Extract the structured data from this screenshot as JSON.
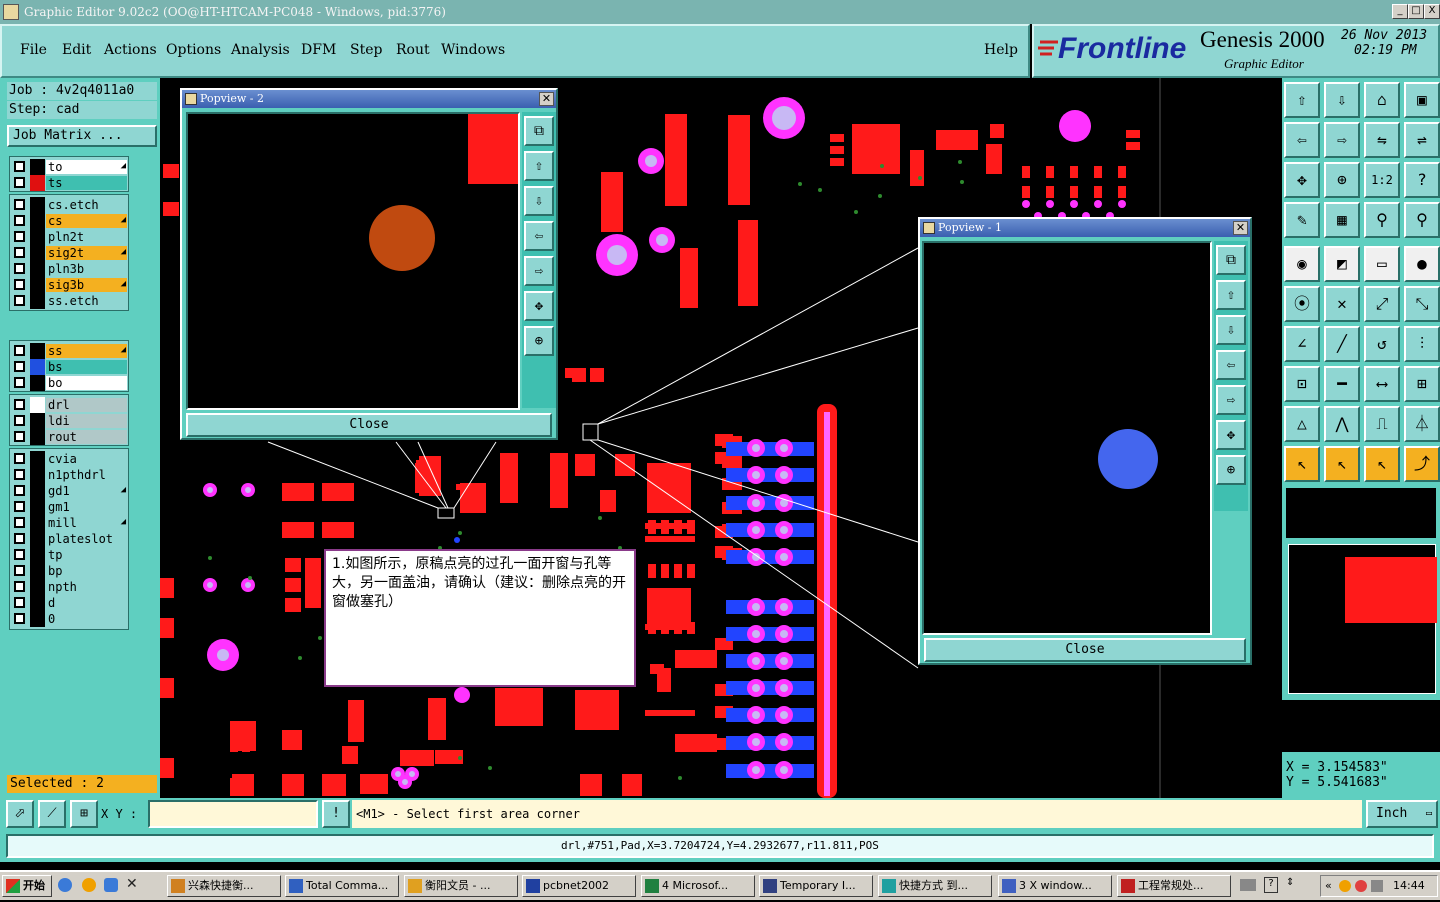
{
  "window": {
    "title": "Graphic Editor 9.02c2  (OO@HT-HTCAM-PC048 - Windows, pid:3776)",
    "min_label": "_",
    "max_label": "□",
    "close_label": "X"
  },
  "menu": {
    "items": [
      "File",
      "Edit",
      "Actions",
      "Options",
      "Analysis",
      "DFM",
      "Step",
      "Rout",
      "Windows"
    ],
    "help": "Help"
  },
  "brand": {
    "logo": "Frontline",
    "product": "Genesis 2000",
    "subtitle": "Graphic Editor",
    "date": "26 Nov 2013",
    "time": "02:19 PM"
  },
  "job": {
    "job_label": "Job : 4v2q4011a0",
    "step_label": "Step: cad",
    "matrix_button": "Job Matrix ..."
  },
  "layers": [
    {
      "name": "to",
      "color": "#000000",
      "bg": "#ffffff",
      "arrow": true,
      "group": 1
    },
    {
      "name": "ts",
      "color": "#e01010",
      "bg": "#3fbfb0",
      "arrow": false,
      "group": 1
    },
    {
      "name": "cs.etch",
      "color": "#000000",
      "bg": "#8fd6d2",
      "arrow": false,
      "group": 2
    },
    {
      "name": "cs",
      "color": "#000000",
      "bg": "#f4b020",
      "arrow": true,
      "group": 2
    },
    {
      "name": "pln2t",
      "color": "#000000",
      "bg": "#8fd6d2",
      "arrow": false,
      "group": 2
    },
    {
      "name": "sig2t",
      "color": "#000000",
      "bg": "#f4b020",
      "arrow": true,
      "group": 2
    },
    {
      "name": "pln3b",
      "color": "#000000",
      "bg": "#8fd6d2",
      "arrow": false,
      "group": 2
    },
    {
      "name": "sig3b",
      "color": "#000000",
      "bg": "#f4b020",
      "arrow": true,
      "group": 2
    },
    {
      "name": "ss.etch",
      "color": "#000000",
      "bg": "#8fd6d2",
      "arrow": false,
      "group": 2
    },
    {
      "name": "ss",
      "color": "#000000",
      "bg": "#f4b020",
      "arrow": true,
      "group": 3
    },
    {
      "name": "bs",
      "color": "#2050e0",
      "bg": "#3fbfb0",
      "arrow": false,
      "group": 3
    },
    {
      "name": "bo",
      "color": "#000000",
      "bg": "#ffffff",
      "arrow": false,
      "group": 3
    },
    {
      "name": "drl",
      "color": "#ffffff",
      "bg": "#b0c8c8",
      "arrow": false,
      "group": 4
    },
    {
      "name": "ldi",
      "color": "#000000",
      "bg": "#b0c8c8",
      "arrow": false,
      "group": 4
    },
    {
      "name": "rout",
      "color": "#000000",
      "bg": "#b0c8c8",
      "arrow": false,
      "group": 4
    },
    {
      "name": "cvia",
      "color": "#000000",
      "bg": "#8fd6d2",
      "arrow": false,
      "group": 5
    },
    {
      "name": "n1pthdrl",
      "color": "#000000",
      "bg": "#8fd6d2",
      "arrow": false,
      "group": 5
    },
    {
      "name": "gd1",
      "color": "#000000",
      "bg": "#8fd6d2",
      "arrow": true,
      "group": 5
    },
    {
      "name": "gm1",
      "color": "#000000",
      "bg": "#8fd6d2",
      "arrow": false,
      "group": 5
    },
    {
      "name": "mill",
      "color": "#000000",
      "bg": "#8fd6d2",
      "arrow": true,
      "group": 5
    },
    {
      "name": "plateslot",
      "color": "#000000",
      "bg": "#8fd6d2",
      "arrow": false,
      "group": 5
    },
    {
      "name": "tp",
      "color": "#000000",
      "bg": "#8fd6d2",
      "arrow": false,
      "group": 5
    },
    {
      "name": "bp",
      "color": "#000000",
      "bg": "#8fd6d2",
      "arrow": false,
      "group": 5
    },
    {
      "name": "npth",
      "color": "#000000",
      "bg": "#8fd6d2",
      "arrow": false,
      "group": 5
    },
    {
      "name": "d",
      "color": "#000000",
      "bg": "#8fd6d2",
      "arrow": false,
      "group": 5
    },
    {
      "name": "0",
      "color": "#000000",
      "bg": "#8fd6d2",
      "arrow": false,
      "group": 5
    }
  ],
  "selected": "Selected : 2",
  "popview2": {
    "title": "Popview - 2",
    "close": "Close",
    "pad_color": "#c04a10"
  },
  "popview1": {
    "title": "Popview - 1",
    "close": "Close",
    "pad_color": "#4466ee"
  },
  "note": {
    "text": "1.如图所示，原稿点亮的过孔一面开窗与孔等大，另一面盖油，请确认（建议：删除点亮的开窗做塞孔）"
  },
  "coords": {
    "x": "X  = 3.154583\"",
    "y": "Y  = 5.541683\""
  },
  "prompt": {
    "xy_label": "X Y :",
    "xy_value": "",
    "message": "<M1> - Select first area corner",
    "units": "Inch"
  },
  "status": "drl,#751,Pad,X=3.7204724,Y=4.2932677,r11.811,POS",
  "taskbar": {
    "start": "开始",
    "tasks": [
      "兴森快捷衡...",
      "Total Comma...",
      "衡阳文员 - ...",
      "pcbnet2002",
      "4 Microsof...",
      "Temporary I...",
      "快捷方式 到...",
      "3 X window...",
      "工程常规处..."
    ],
    "clock": "14:44"
  },
  "colors": {
    "accent": "#5fcfc0",
    "panel": "#8fd6d2",
    "copper": "#ff1a1a",
    "via": "#ff33ff",
    "bottom": "#2244ff"
  }
}
